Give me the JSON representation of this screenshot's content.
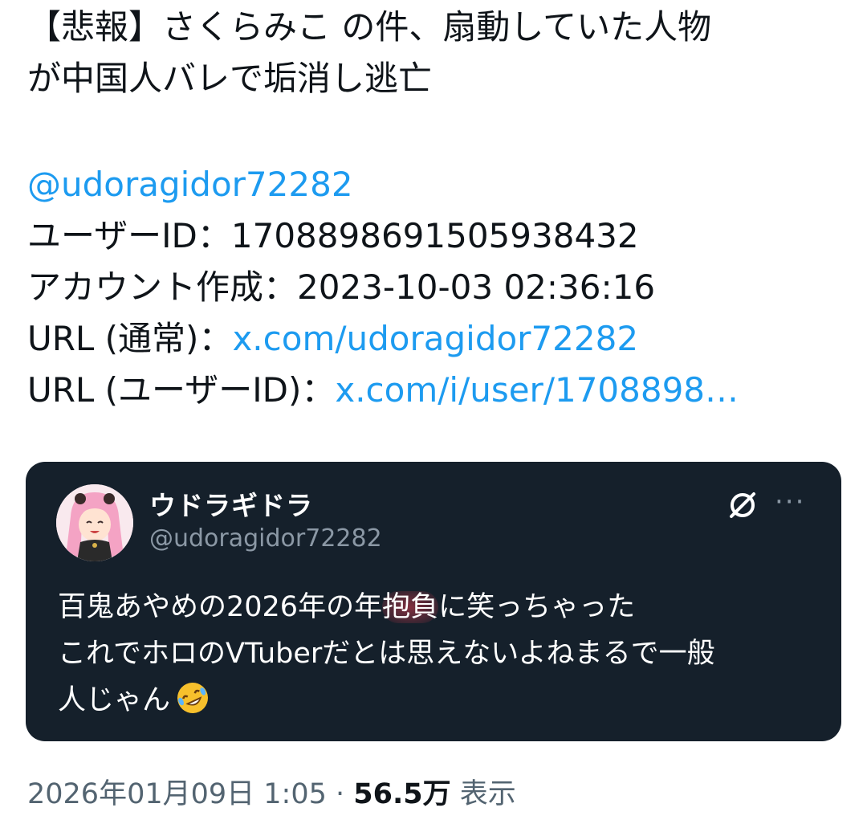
{
  "tweet": {
    "title_line1": "【悲報】さくらみこ の件、扇動していた人物",
    "title_line2": "が中国人バレで垢消し逃亡",
    "mention": "@udoragidor72282",
    "user_id_label": "ユーザーID：",
    "user_id_value": "1708898691505938432",
    "created_label": "アカウント作成：",
    "created_value": "2023-10-03 02:36:16",
    "url_normal_label": "URL (通常)：",
    "url_normal_link": "x.com/udoragidor72282",
    "url_id_label": "URL (ユーザーID)：",
    "url_id_link": "x.com/i/user/1708898…"
  },
  "quote": {
    "display_name": "ウドラギドラ",
    "handle": "@udoragidor72282",
    "line1_a": "百鬼あやめの2026年の年",
    "line1_highlight": "抱負",
    "line1_b": "に笑っちゃった",
    "line2": "これでホロのVTuberだとは思えないよねまるで一般",
    "line3": "人じゃん",
    "emoji_icon": "rolling-on-floor-laughing-icon",
    "hide_icon": "slashed-circle-icon",
    "more_icon": "more-icon",
    "more_glyph": "···"
  },
  "meta": {
    "timestamp": "2026年01月09日 1:05",
    "separator": " · ",
    "views_count": "56.5万",
    "views_label": " 表示"
  },
  "colors": {
    "link": "#1d9bf0",
    "quote_bg": "#15202b",
    "muted": "#536471"
  }
}
